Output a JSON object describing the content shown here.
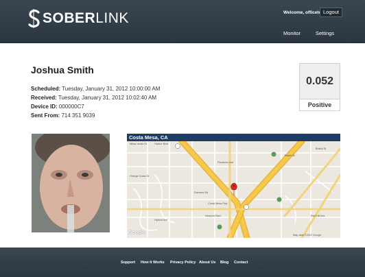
{
  "header": {
    "brand": {
      "bold": "SOBER",
      "light": "LINK"
    },
    "welcome": "Welcome, officetest",
    "logout_label": "Logout",
    "nav": {
      "monitor": "Monitor",
      "settings": "Settings"
    }
  },
  "test": {
    "name": "Joshua Smith",
    "scheduled": {
      "label": "Scheduled:",
      "value": "Tuesday, January 31, 2012 10:00:00 AM"
    },
    "received": {
      "label": "Received:",
      "value": "Tuesday, January 31, 2012 10:02:40 AM"
    },
    "device": {
      "label": "Device ID:",
      "value": "000000C7"
    },
    "sent_from": {
      "label": "Sent From:",
      "value": "714 351 9039"
    },
    "bac": "0.052",
    "status": "Positive"
  },
  "map": {
    "title": "Costa Mesa, CA",
    "labels": [
      "Mesa Verde Dr",
      "Harbor Blvd",
      "Baker St",
      "Paularino Ave",
      "Bristol St",
      "Red Hill Ave",
      "Newport Blvd",
      "Costa Mesa Fwy",
      "Fairview Rd",
      "Orange Coast Dr",
      "Hyland Ave"
    ],
    "google_text": "Google",
    "copyright": "Map data ©2012 Google"
  },
  "footer": {
    "links": [
      "Support",
      "How It Works",
      "Privacy Policy",
      "About Us",
      "Blog",
      "Contact"
    ]
  },
  "colors": {
    "header_bg": "#2f3a44",
    "map_title_bg": "#1e3c66",
    "freeway": "#f7c94a"
  }
}
